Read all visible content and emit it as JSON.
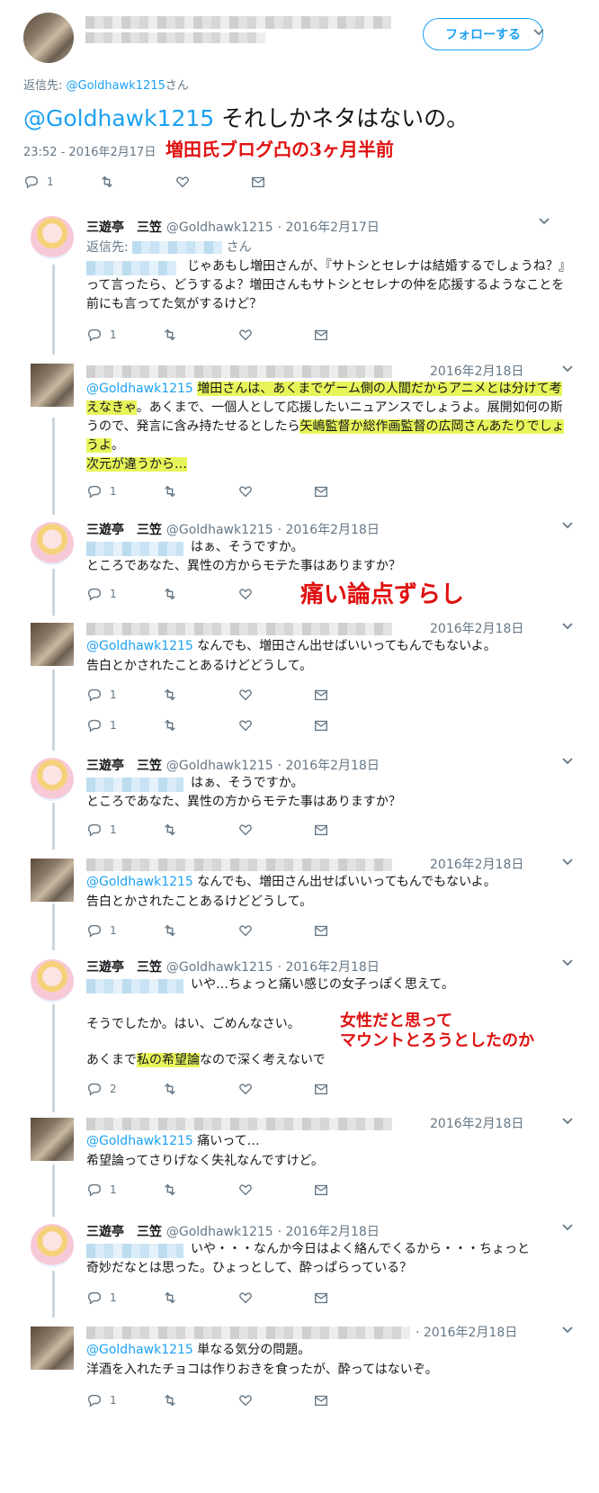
{
  "top": {
    "follow_label": "フォローする",
    "reply_to_prefix": "返信先:",
    "reply_to_handle": "@Goldhawk1215",
    "reply_to_suffix": "さん",
    "text_mention": "@Goldhawk1215",
    "text_rest": " それしかネタはないの。",
    "timestamp": "23:52 - 2016年2月17日",
    "reply_count": "1",
    "annotation": "増田氏ブログ凸の3ヶ月半前"
  },
  "replies": [
    {
      "name": "三遊亭　三笠",
      "handle": "@Goldhawk1215",
      "date": "· 2016年2月17日",
      "reply_to_prefix": "返信先:",
      "reply_to_suffix": "さん",
      "body": "じゃあもし増田さんが、『サトシとセレナは結婚するでしょうね？』って言ったら、どうするよ？増田さんもサトシとセレナの仲を応援するようなことを前にも言ってた気がするけど？",
      "reply_count": "1"
    },
    {
      "date": "2016年2月18日",
      "mention": "@Goldhawk1215",
      "seg1_hl": "増田さんは、あくまでゲーム側の人間だからアニメとは分けて考えなきゃ",
      "seg2": "。あくまで、一個人として応援したいニュアンスでしょうよ。展開如何の斯うので、発言に含み持たせるとしたら",
      "seg3_hl": "矢嶋監督か総作画監督の広岡さんあたりでしょうよ",
      "seg4": "。",
      "seg5_hl": "次元が違うから…",
      "reply_count": "1"
    },
    {
      "name": "三遊亭　三笠",
      "handle": "@Goldhawk1215",
      "date": "· 2016年2月18日",
      "line1": "はぁ、そうですか。",
      "line2": "ところであなた、異性の方からモテた事はありますか？",
      "reply_count": "1",
      "annotation": "痛い論点ずらし"
    },
    {
      "date": "2016年2月18日",
      "mention": "@Goldhawk1215",
      "line1": " なんでも、増田さん出せばいいってもんでもないよ。",
      "line2": "告白とかされたことあるけどどうして。",
      "reply_count": "1",
      "reply_count_b": "1"
    },
    {
      "name": "三遊亭　三笠",
      "handle": "@Goldhawk1215",
      "date": "· 2016年2月18日",
      "line1": "はぁ、そうですか。",
      "line2": "ところであなた、異性の方からモテた事はありますか？",
      "reply_count": "1"
    },
    {
      "date": "2016年2月18日",
      "mention": "@Goldhawk1215",
      "line1": " なんでも、増田さん出せばいいってもんでもないよ。",
      "line2": "告白とかされたことあるけどどうして。",
      "reply_count": "1"
    },
    {
      "name": "三遊亭　三笠",
      "handle": "@Goldhawk1215",
      "date": "· 2016年2月18日",
      "line1": "いや…ちょっと痛い感じの女子っぽく思えて。",
      "line2": "そうでしたか。はい、ごめんなさい。",
      "line3a": "あくまで",
      "line3hl": "私の希望論",
      "line3b": "なので深く考えないで",
      "reply_count": "2",
      "annotation1": "女性だと思って",
      "annotation2": "マウントとろうとしたのか"
    },
    {
      "date": "2016年2月18日",
      "mention": "@Goldhawk1215",
      "line1": " 痛いって…",
      "line2": "希望論ってさりげなく失礼なんですけど。",
      "reply_count": "1"
    },
    {
      "name": "三遊亭　三笠",
      "handle": "@Goldhawk1215",
      "date": "· 2016年2月18日",
      "line1": "いや・・・なんか今日はよく絡んでくるから・・・ちょっと",
      "line2": "奇妙だなとは思った。ひょっとして、酔っぱらっている？",
      "reply_count": "1"
    },
    {
      "date": "· 2016年2月18日",
      "mention": "@Goldhawk1215",
      "line1": " 単なる気分の問題。",
      "line2": "洋酒を入れたチョコは作りおきを食ったが、酔ってはないぞ。",
      "reply_count": "1"
    }
  ]
}
